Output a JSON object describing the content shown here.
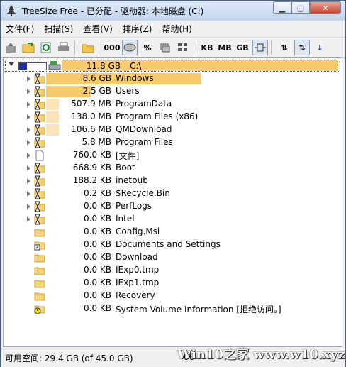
{
  "window": {
    "title": "TreeSize Free - 已分配 - 驱动器: 本地磁盘 (C:)",
    "controls": [
      "minimize-icon",
      "maximize-icon",
      "close-icon"
    ]
  },
  "menu": [
    "文件(F)",
    "扫描(S)",
    "查看(V)",
    "排序(Z)",
    "帮助(H)"
  ],
  "toolbar": {
    "kb": "KB",
    "mb": "MB",
    "gb": "GB",
    "percent": "%",
    "digits": "000"
  },
  "root": {
    "size": "11.8 GB",
    "name": "C:\\"
  },
  "rows": [
    {
      "size": "8.6 GB",
      "name": "Windows",
      "expandable": true,
      "icon": "folder-hourglass-icon",
      "share": 0.73
    },
    {
      "size": "2.5 GB",
      "name": "Users",
      "expandable": true,
      "icon": "folder-hourglass-icon",
      "share": 0.21
    },
    {
      "size": "507.9 MB",
      "name": "ProgramData",
      "expandable": true,
      "icon": "folder-hourglass-icon",
      "share": 0.04
    },
    {
      "size": "138.0 MB",
      "name": "Program Files (x86)",
      "expandable": true,
      "icon": "folder-hourglass-icon",
      "share": 0.01
    },
    {
      "size": "106.6 MB",
      "name": "QMDownload",
      "expandable": true,
      "icon": "folder-hourglass-icon",
      "share": 0.01
    },
    {
      "size": "5.8 MB",
      "name": "Program Files",
      "expandable": true,
      "icon": "folder-hourglass-icon",
      "share": 0
    },
    {
      "size": "760.0 KB",
      "name": "[文件]",
      "expandable": true,
      "icon": "file-icon",
      "share": 0
    },
    {
      "size": "668.9 KB",
      "name": "Boot",
      "expandable": true,
      "icon": "folder-hourglass-icon",
      "share": 0
    },
    {
      "size": "188.2 KB",
      "name": "inetpub",
      "expandable": true,
      "icon": "folder-hourglass-icon",
      "share": 0
    },
    {
      "size": "0.2 KB",
      "name": "$Recycle.Bin",
      "expandable": true,
      "icon": "folder-hourglass-icon",
      "share": 0
    },
    {
      "size": "0.0 KB",
      "name": "PerfLogs",
      "expandable": true,
      "icon": "folder-hourglass-icon",
      "share": 0
    },
    {
      "size": "0.0 KB",
      "name": "Intel",
      "expandable": true,
      "icon": "folder-hourglass-icon",
      "share": 0
    },
    {
      "size": "0.0 KB",
      "name": "Config.Msi",
      "expandable": false,
      "icon": "folder-icon",
      "share": 0
    },
    {
      "size": "0.0 KB",
      "name": "Documents and Settings",
      "expandable": false,
      "icon": "folder-shortcut-icon",
      "share": 0
    },
    {
      "size": "0.0 KB",
      "name": "Download",
      "expandable": false,
      "icon": "folder-icon",
      "share": 0
    },
    {
      "size": "0.0 KB",
      "name": "IExp0.tmp",
      "expandable": false,
      "icon": "folder-icon",
      "share": 0
    },
    {
      "size": "0.0 KB",
      "name": "IExp1.tmp",
      "expandable": false,
      "icon": "folder-icon",
      "share": 0
    },
    {
      "size": "0.0 KB",
      "name": "Recovery",
      "expandable": false,
      "icon": "folder-icon",
      "share": 0
    },
    {
      "size": "0.0 KB",
      "name": "System Volume Information [拒绝访问。]",
      "expandable": false,
      "icon": "folder-warning-icon",
      "share": 0
    }
  ],
  "status": {
    "free_space": "可用空间: 29.4 GB  (of 45.0 GB)",
    "right": "06"
  },
  "watermark": "Win10之家 www.w10.xyz",
  "colors": {
    "bar": "#f8ca6e",
    "bar_light": "#fce6b9",
    "title_bg": "#c3d6ee"
  }
}
